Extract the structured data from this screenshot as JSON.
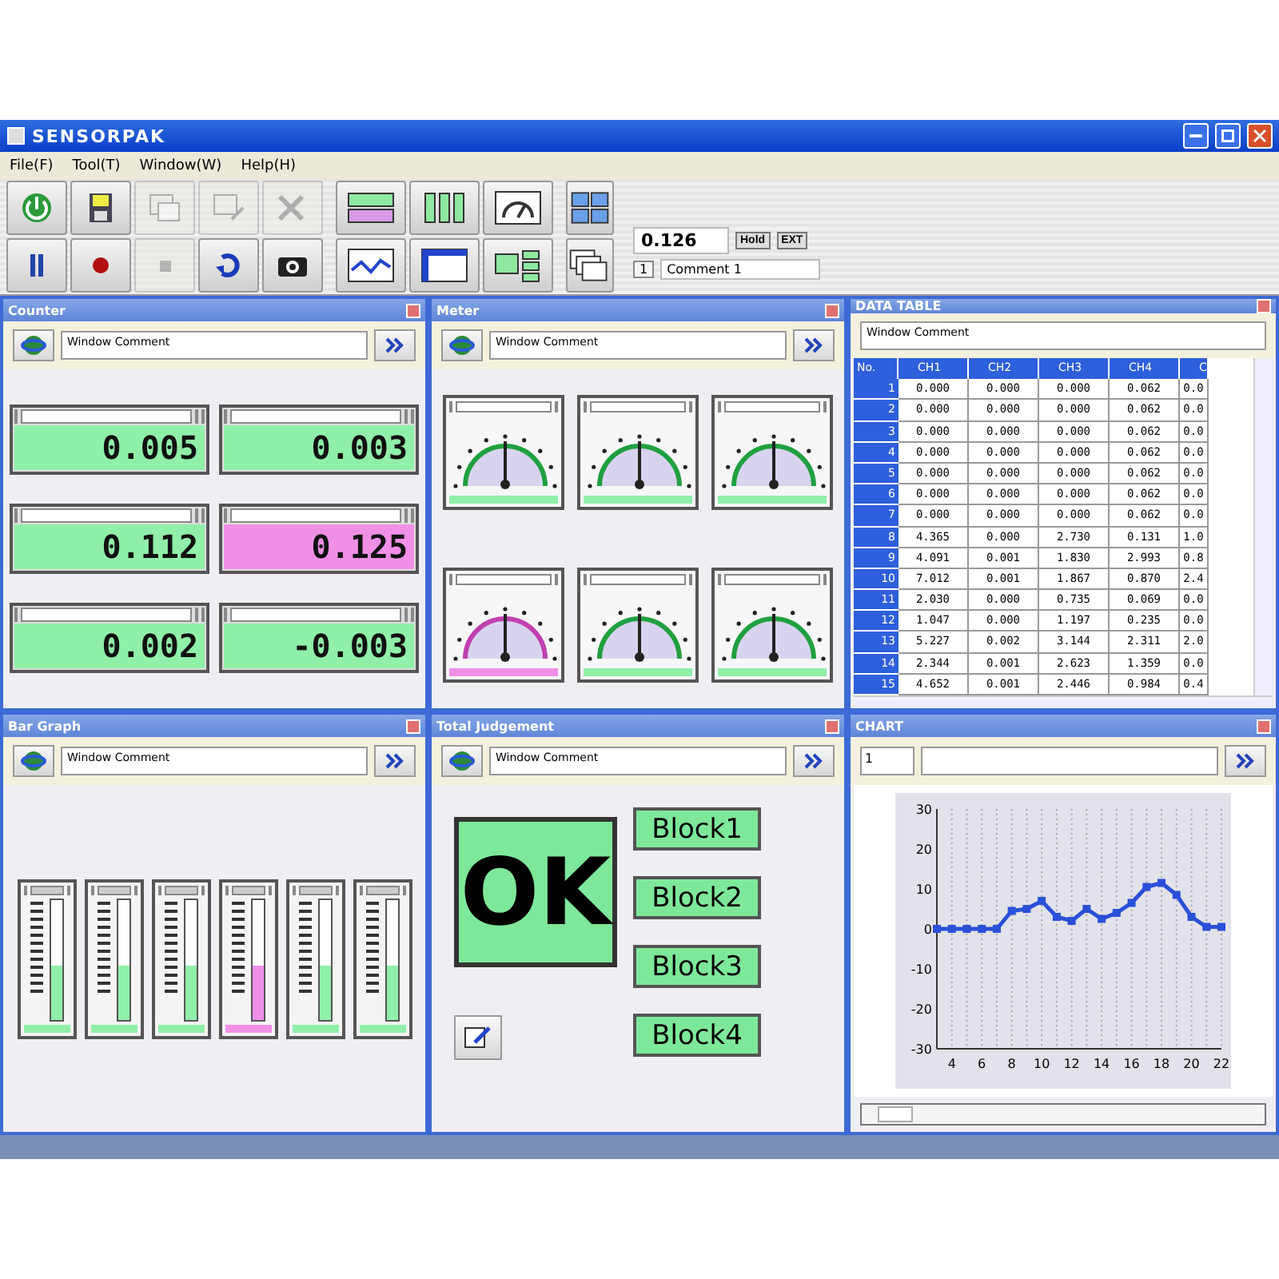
{
  "window": {
    "title": "SENSORPAK"
  },
  "menu": [
    "File(F)",
    "Tool(T)",
    "Window(W)",
    "Help(H)"
  ],
  "toolbar": {
    "groups": [
      [
        {
          "kind": "power",
          "disabled": false
        },
        {
          "kind": "pause",
          "disabled": false
        },
        {
          "kind": "save",
          "disabled": false
        },
        {
          "kind": "record",
          "disabled": false
        },
        {
          "kind": "window",
          "disabled": true
        },
        {
          "kind": "stop",
          "disabled": true
        },
        {
          "kind": "window-edit",
          "disabled": true
        },
        {
          "kind": "refresh",
          "disabled": false
        },
        {
          "kind": "tools",
          "disabled": true
        },
        {
          "kind": "camera",
          "disabled": false
        }
      ],
      [
        {
          "kind": "counter",
          "disabled": false
        },
        {
          "kind": "chart",
          "disabled": false
        },
        {
          "kind": "bars",
          "disabled": false
        },
        {
          "kind": "table",
          "disabled": false
        },
        {
          "kind": "gauge",
          "disabled": false
        },
        {
          "kind": "judgement",
          "disabled": false
        }
      ],
      [
        {
          "kind": "tile",
          "disabled": false
        },
        {
          "kind": "cascade",
          "disabled": false
        }
      ]
    ]
  },
  "readout": {
    "value": "0.126",
    "hold": "Hold",
    "ext": "EXT",
    "number": "1",
    "comment": "Comment 1"
  },
  "counter": {
    "title": "Counter",
    "comment": "Window Comment",
    "counters": [
      {
        "value": "0.005",
        "alarm": false
      },
      {
        "value": "0.003",
        "alarm": false
      },
      {
        "value": "0.112",
        "alarm": false
      },
      {
        "value": "0.125",
        "alarm": true
      },
      {
        "value": "0.002",
        "alarm": false
      },
      {
        "value": "-0.003",
        "alarm": false
      }
    ]
  },
  "meter": {
    "title": "Meter",
    "comment": "Window Comment",
    "meters": [
      {
        "alarm": false
      },
      {
        "alarm": false
      },
      {
        "alarm": false
      },
      {
        "alarm": true
      },
      {
        "alarm": false
      },
      {
        "alarm": false
      }
    ]
  },
  "data_table": {
    "title": "DATA TABLE",
    "comment": "Window Comment",
    "columns": [
      "No.",
      "CH1",
      "CH2",
      "CH3",
      "CH4",
      "C"
    ],
    "rows": [
      [
        "1",
        "0.000",
        "0.000",
        "0.000",
        "0.062",
        "0.0"
      ],
      [
        "2",
        "0.000",
        "0.000",
        "0.000",
        "0.062",
        "0.0"
      ],
      [
        "3",
        "0.000",
        "0.000",
        "0.000",
        "0.062",
        "0.0"
      ],
      [
        "4",
        "0.000",
        "0.000",
        "0.000",
        "0.062",
        "0.0"
      ],
      [
        "5",
        "0.000",
        "0.000",
        "0.000",
        "0.062",
        "0.0"
      ],
      [
        "6",
        "0.000",
        "0.000",
        "0.000",
        "0.062",
        "0.0"
      ],
      [
        "7",
        "0.000",
        "0.000",
        "0.000",
        "0.062",
        "0.0"
      ],
      [
        "8",
        "4.365",
        "0.000",
        "2.730",
        "0.131",
        "1.0"
      ],
      [
        "9",
        "4.091",
        "0.001",
        "1.830",
        "2.993",
        "0.8"
      ],
      [
        "10",
        "7.012",
        "0.001",
        "1.867",
        "0.870",
        "2.4"
      ],
      [
        "11",
        "2.030",
        "0.000",
        "0.735",
        "0.069",
        "0.0"
      ],
      [
        "12",
        "1.047",
        "0.000",
        "1.197",
        "0.235",
        "0.0"
      ],
      [
        "13",
        "5.227",
        "0.002",
        "3.144",
        "2.311",
        "2.0"
      ],
      [
        "14",
        "2.344",
        "0.001",
        "2.623",
        "1.359",
        "0.0"
      ],
      [
        "15",
        "4.652",
        "0.001",
        "2.446",
        "0.984",
        "0.4"
      ]
    ]
  },
  "bar_graph": {
    "title": "Bar Graph",
    "comment": "Window Comment",
    "bars": [
      {
        "level": 0.45,
        "alarm": false
      },
      {
        "level": 0.45,
        "alarm": false
      },
      {
        "level": 0.45,
        "alarm": false
      },
      {
        "level": 0.45,
        "alarm": true
      },
      {
        "level": 0.45,
        "alarm": false
      },
      {
        "level": 0.45,
        "alarm": false
      }
    ]
  },
  "judgement": {
    "title": "Total Judgement",
    "comment": "Window Comment",
    "result": "OK",
    "blocks": [
      "Block1",
      "Block2",
      "Block3",
      "Block4"
    ]
  },
  "chart": {
    "title": "CHART",
    "channel": "1",
    "chart_data": {
      "type": "line",
      "x": [
        3,
        4,
        5,
        6,
        7,
        8,
        9,
        10,
        11,
        12,
        13,
        14,
        15,
        16,
        17,
        18,
        19,
        20,
        21,
        22
      ],
      "grid": true,
      "series": [
        {
          "color": "#2a4fd8",
          "marker": "square",
          "values": [
            0,
            0,
            0,
            0,
            0,
            4.5,
            5,
            7,
            3,
            2,
            5,
            2.5,
            4,
            6.5,
            10.5,
            11.5,
            8.5,
            3,
            0.5,
            0.5
          ]
        }
      ],
      "xlim": [
        3,
        22
      ],
      "ylim": [
        -30,
        30
      ],
      "xticks": [
        4,
        6,
        8,
        10,
        12,
        14,
        16,
        18,
        20,
        22
      ],
      "yticks": [
        -30,
        -20,
        -10,
        0,
        10,
        20,
        30
      ]
    }
  }
}
